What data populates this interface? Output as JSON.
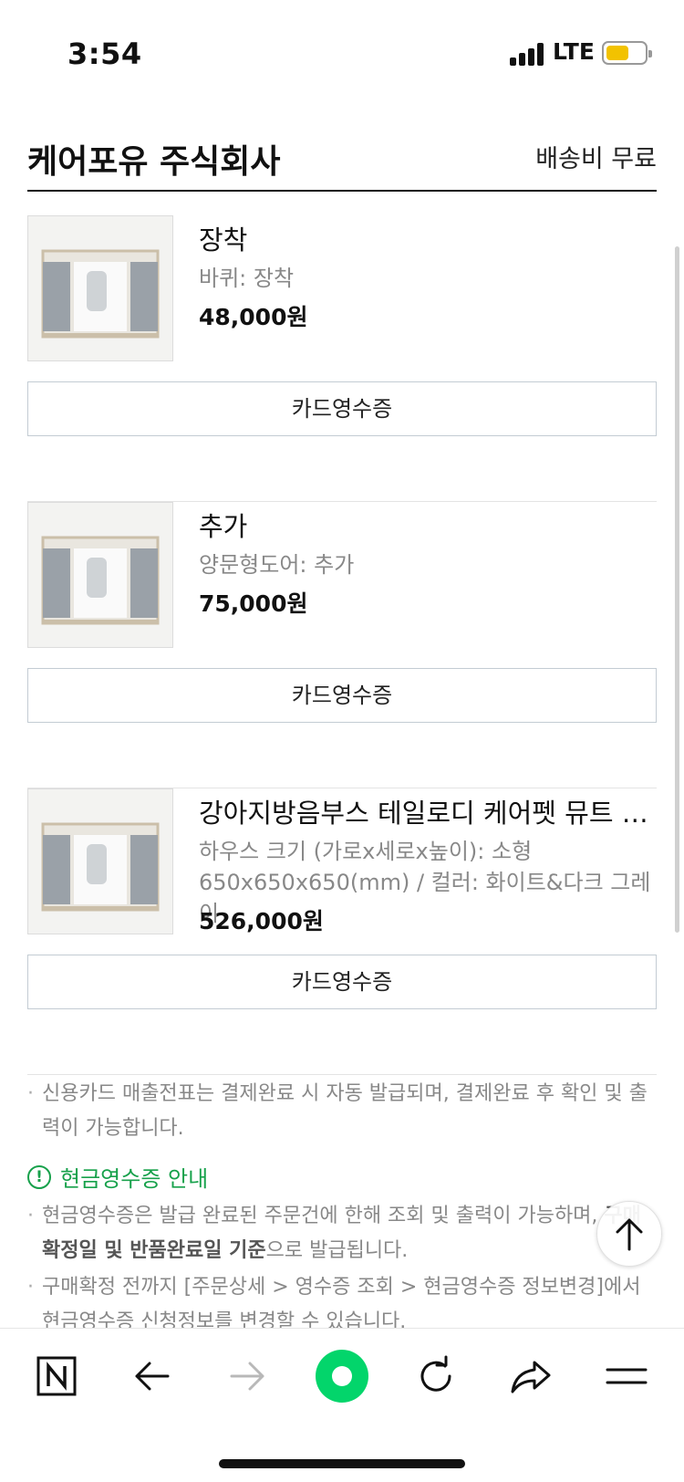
{
  "status_bar": {
    "time": "3:54",
    "network": "LTE",
    "battery_level": 0.6
  },
  "seller": {
    "name": "케어포유 주식회사",
    "shipping": "배송비 무료"
  },
  "orders": [
    {
      "title": "장착",
      "option": "바퀴: 장착",
      "price": "48,000원",
      "receipt_label": "카드영수증"
    },
    {
      "title": "추가",
      "option": "양문형도어: 추가",
      "price": "75,000원",
      "receipt_label": "카드영수증"
    },
    {
      "title": "강아지방음부스 테일로디 케어펫 뮤트 스퀘…",
      "option": "하우스 크기 (가로x세로x높이): 소형 650x650x650(mm) / 컬러: 화이트&다크 그레이",
      "price": "526,000원",
      "receipt_label": "카드영수증"
    }
  ],
  "card_notice": "신용카드 매출전표는 결제완료 시 자동 발급되며, 결제완료 후 확인 및 출력이 가능합니다.",
  "cash_receipt": {
    "icon": "exclamation-circle-icon",
    "title": "현금영수증 안내",
    "note1_a": "현금영수증은 발급 완료된 주문건에 한해 조회 및 출력이 가능하며, ",
    "note1_bold": "구매확정일 및 반품완료일 기준",
    "note1_b": "으로 발급됩니다.",
    "note2": "구매확정 전까지 [주문상세 > 영수증 조회 > 현금영수증 정보변경]에서 현금영수증 신청정보를 변경할 수 있습니다."
  },
  "toolbar": {
    "items": [
      "naver-n-icon",
      "back-arrow-icon",
      "forward-arrow-icon",
      "green-dot-icon",
      "refresh-icon",
      "share-icon",
      "menu-icon"
    ]
  },
  "colors": {
    "accent_green": "#17a14b",
    "toolbar_green": "#03d56b",
    "battery_yellow": "#f2c200"
  }
}
